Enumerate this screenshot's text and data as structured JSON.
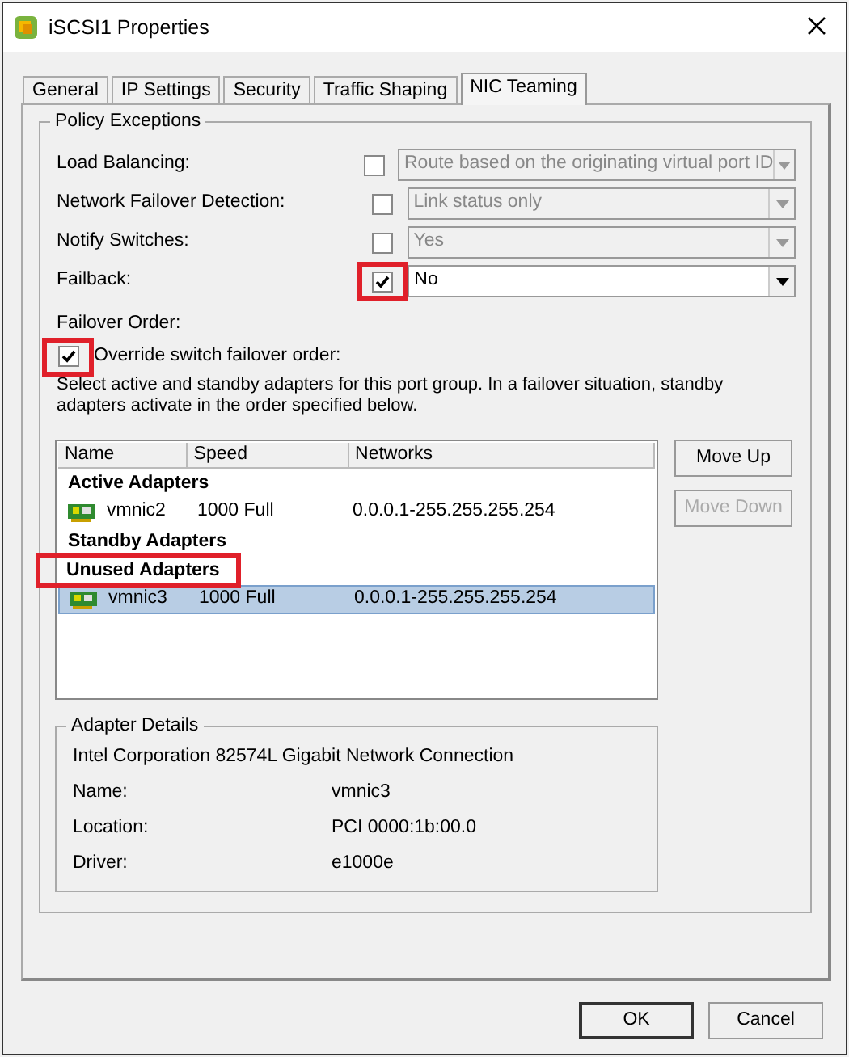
{
  "window": {
    "title": "iSCSI1 Properties"
  },
  "tabs": [
    {
      "label": "General",
      "selected": false
    },
    {
      "label": "IP Settings",
      "selected": false
    },
    {
      "label": "Security",
      "selected": false
    },
    {
      "label": "Traffic Shaping",
      "selected": false
    },
    {
      "label": "NIC Teaming",
      "selected": true
    }
  ],
  "policy_exceptions": {
    "title": "Policy Exceptions",
    "rows": [
      {
        "label": "Load Balancing:",
        "checked": false,
        "highlighted": false,
        "value": "Route based on the originating virtual port ID",
        "disabled": true
      },
      {
        "label": "Network Failover Detection:",
        "checked": false,
        "highlighted": false,
        "value": "Link status only",
        "disabled": true
      },
      {
        "label": "Notify Switches:",
        "checked": false,
        "highlighted": false,
        "value": "Yes",
        "disabled": true
      },
      {
        "label": "Failback:",
        "checked": true,
        "highlighted": true,
        "value": "No",
        "disabled": false
      }
    ]
  },
  "failover_order": {
    "title": "Failover Order:",
    "override": {
      "label": "Override switch failover order:",
      "checked": true,
      "highlighted": true
    },
    "description": "Select active and standby adapters for this port group.  In a failover situation, standby adapters activate  in the order specified below."
  },
  "adapters": {
    "columns": [
      "Name",
      "Speed",
      "Networks"
    ],
    "groups": [
      {
        "title": "Active Adapters",
        "highlighted": false,
        "items": [
          {
            "name": "vmnic2",
            "speed": "1000 Full",
            "networks": "0.0.0.1-255.255.255.254",
            "selected": false
          }
        ]
      },
      {
        "title": "Standby Adapters",
        "highlighted": false
      },
      {
        "title": "Unused Adapters",
        "highlighted": true,
        "items": [
          {
            "name": "vmnic3",
            "speed": "1000 Full",
            "networks": "0.0.0.1-255.255.255.254",
            "selected": true
          }
        ]
      }
    ]
  },
  "side_buttons": [
    {
      "label": "Move Up",
      "disabled": false
    },
    {
      "label": "Move Down",
      "disabled": true
    }
  ],
  "adapter_details": {
    "title": "Adapter Details",
    "description": "Intel Corporation 82574L Gigabit Network Connection",
    "fields": [
      {
        "label": "Name:",
        "value": "vmnic3"
      },
      {
        "label": "Location:",
        "value": "PCI 0000:1b:00.0"
      },
      {
        "label": "Driver:",
        "value": "e1000e"
      }
    ]
  },
  "buttons": [
    {
      "label": "OK",
      "default": true
    },
    {
      "label": "Cancel",
      "default": false
    }
  ]
}
